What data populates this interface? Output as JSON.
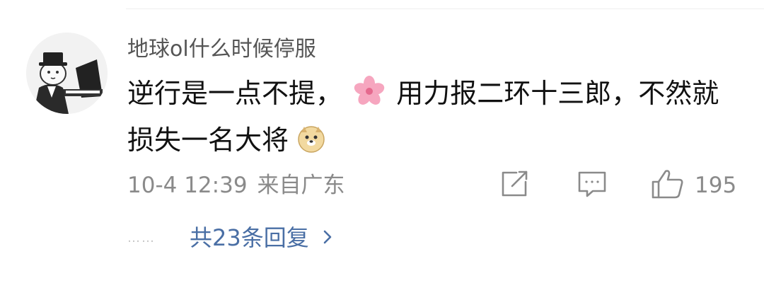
{
  "comment": {
    "username": "地球ol什么时候停服",
    "text_part1": "逆行是一点不提，",
    "text_part2": "用力报二环十三郎，不然就损失一名大将",
    "emoji_1": "flower-emoji",
    "emoji_2": "doge-emoji",
    "timestamp": "10-4 12:39",
    "location": "来自广东",
    "like_count": "195",
    "replies_label": "共23条回复",
    "replies_dots": "……"
  },
  "icons": {
    "share": "share-icon",
    "comment": "comment-icon",
    "like": "thumbs-up-icon",
    "chevron": "chevron-right-icon"
  },
  "colors": {
    "link": "#4a6fa5",
    "meta_text": "#8a8a8a",
    "body_text": "#111111"
  }
}
